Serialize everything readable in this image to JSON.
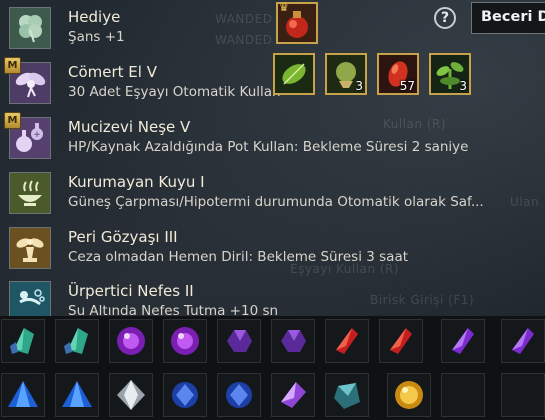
{
  "skills": [
    {
      "name": "Hediye",
      "desc": "Şans +1",
      "mastery_badge": "",
      "icon": "clover-icon"
    },
    {
      "name": "Cömert El V",
      "desc": "30 Adet Eşyayı Otomatik Kullan",
      "mastery_badge": "M",
      "icon": "fairy-icon"
    },
    {
      "name": "Mucizevi Neşe V",
      "desc": "HP/Kaynak Azaldığında Pot Kullan: Bekleme Süresi 2 saniye",
      "mastery_badge": "M",
      "icon": "potion-bottles-icon"
    },
    {
      "name": "Kurumayan Kuyu I",
      "desc": "Güneş Çarpması/Hipotermi durumunda Otomatik olarak Saf...",
      "mastery_badge": "",
      "icon": "steaming-bowl-icon"
    },
    {
      "name": "Peri Gözyaşı III",
      "desc": "Ceza olmadan Hemen Diril: Bekleme Süresi 3 saat",
      "mastery_badge": "",
      "icon": "angel-statue-icon"
    },
    {
      "name": "Ürpertici Nefes II",
      "desc": "Su Altında Nefes Tutma +10 sn",
      "mastery_badge": "",
      "icon": "swimmer-icon"
    }
  ],
  "popup": {
    "main_item": {
      "icon": "red-potion-icon",
      "crown_icon": "crown-icon"
    },
    "items": [
      {
        "icon": "green-leaf-icon",
        "count": ""
      },
      {
        "icon": "green-herb-bundle-icon",
        "count": "3"
      },
      {
        "icon": "red-seed-icon",
        "count": "57"
      },
      {
        "icon": "green-sprout-icon",
        "count": "3"
      }
    ]
  },
  "header": {
    "help_label": "?",
    "skill_button_label": "Beceri De"
  },
  "background_text": [
    "WANDED",
    "WANDED",
    "Kullan (R)",
    "Eşyayı Kullan (R)",
    "Birisk Girişi (F1)",
    "Ulan"
  ],
  "inventory": {
    "row1": [
      "green-crystal-icon",
      "green-crystal-icon",
      "purple-orb-icon",
      "purple-orb-icon",
      "purple-gem-icon",
      "purple-gem-icon",
      "red-crystal-icon",
      "red-crystal-icon",
      "violet-crystal-icon",
      "violet-crystal-icon"
    ],
    "row2": [
      "blue-triangle-gem-icon",
      "blue-triangle-gem-icon",
      "silver-diamond-icon",
      "blue-round-gem-icon",
      "blue-round-gem-icon",
      "violet-shard-icon",
      "teal-stone-icon",
      "gold-orb-icon",
      "",
      ""
    ]
  },
  "colors": {
    "item_frame": "#c8a24a",
    "mastery_badge": "#d8b555",
    "background": "#1d2329"
  }
}
